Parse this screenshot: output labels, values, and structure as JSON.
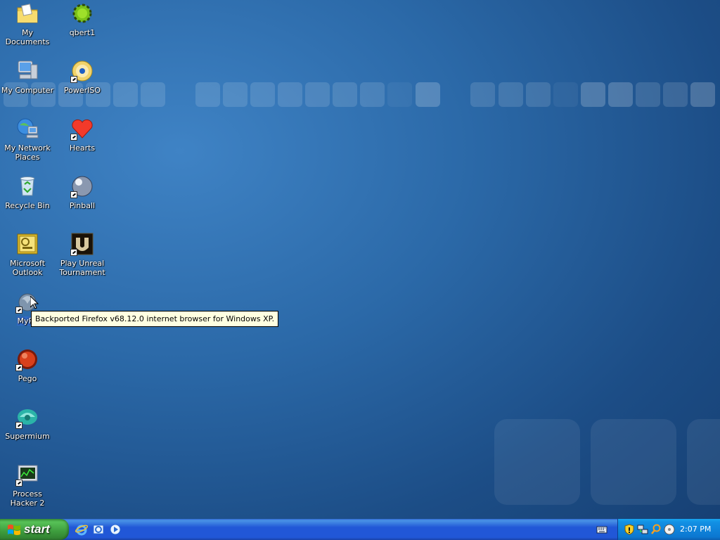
{
  "desktop": {
    "icons": [
      {
        "label": "My Documents",
        "icon": "folder-icon"
      },
      {
        "label": "qbert1",
        "icon": "qbert-icon"
      },
      {
        "label": "My Computer",
        "icon": "computer-icon"
      },
      {
        "label": "PowerISO",
        "icon": "disc-icon"
      },
      {
        "label": "My Network Places",
        "icon": "network-icon"
      },
      {
        "label": "Hearts",
        "icon": "heart-icon"
      },
      {
        "label": "Recycle Bin",
        "icon": "recycle-bin-icon"
      },
      {
        "label": "Pinball",
        "icon": "pinball-icon"
      },
      {
        "label": "Microsoft Outlook",
        "icon": "outlook-icon"
      },
      {
        "label": "Play Unreal Tournament",
        "icon": "unreal-icon"
      },
      {
        "label": "MyPa",
        "icon": "mypal-icon"
      },
      {
        "label": "Pego",
        "icon": "pego-icon"
      },
      {
        "label": "Supermium",
        "icon": "supermium-icon"
      },
      {
        "label": "Process Hacker 2",
        "icon": "process-hacker-icon"
      }
    ],
    "tooltip": "Backported Firefox v68.12.0 internet browser for Windows XP."
  },
  "taskbar": {
    "start_label": "start",
    "quick_launch": [
      "internet-explorer-icon",
      "outlook-express-icon",
      "media-player-icon"
    ],
    "tray_icons": [
      "security-shield-icon",
      "network-icon",
      "search-icon",
      "disc-icon"
    ],
    "clock": "2:07 PM"
  },
  "colors": {
    "desktop_blue": "#2b69a8",
    "taskbar_blue": "#2157d7",
    "start_green": "#3d9c3d",
    "tray_blue": "#0c77d1",
    "tooltip_bg": "#ffffe1",
    "selection": "#316ac5"
  }
}
